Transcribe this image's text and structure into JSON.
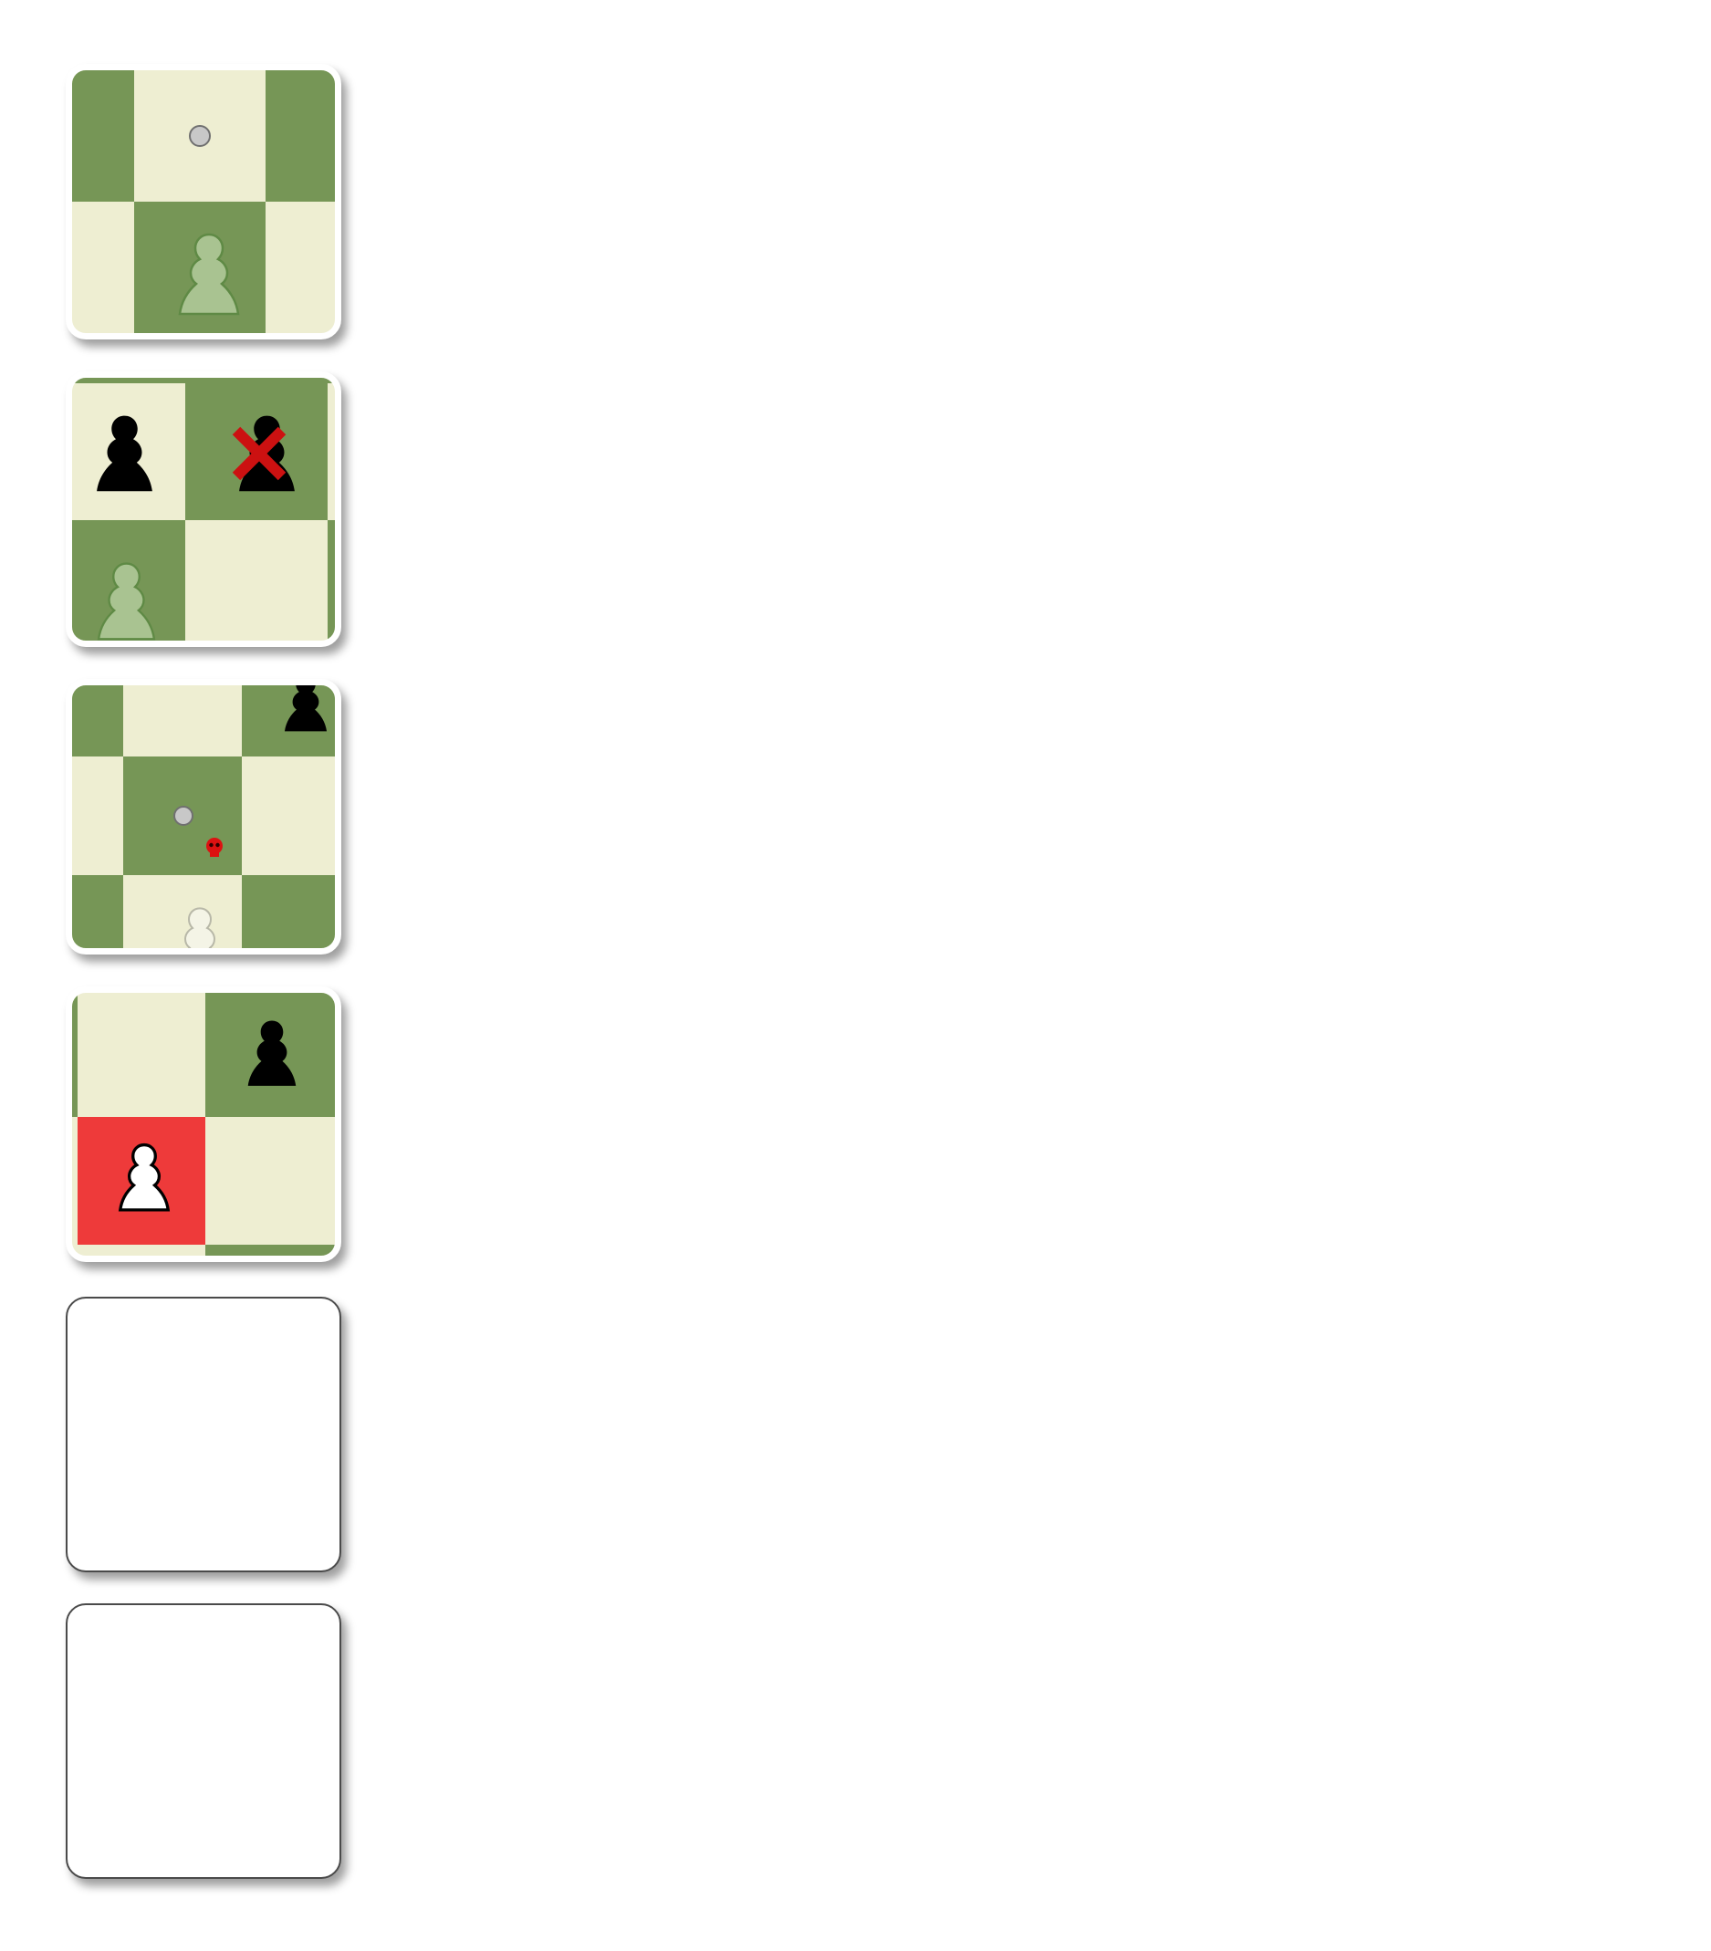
{
  "palette": {
    "light_square": "#eeeed2",
    "dark_square": "#769656",
    "highlight_square": "#ee3a3a",
    "move_dot": "#c8c8c8",
    "capture_cross": "#cc1111",
    "skull_marker": "#dd1111"
  },
  "tutorial_cards": [
    {
      "id": "card-1",
      "content": "pawn-single-step",
      "icons": [
        "ghost-pawn-icon",
        "move-dot-icon"
      ]
    },
    {
      "id": "card-2",
      "content": "blocked-capture",
      "icons": [
        "black-pawn-icon",
        "captured-black-pawn-icon",
        "cross-mark-icon",
        "ghost-pawn-icon"
      ]
    },
    {
      "id": "card-3",
      "content": "danger-square",
      "icons": [
        "black-pawn-icon",
        "move-dot-icon",
        "skull-icon",
        "faded-pawn-icon"
      ]
    },
    {
      "id": "card-4",
      "content": "attacked-pawn",
      "icons": [
        "black-pawn-icon",
        "white-pawn-icon"
      ]
    },
    {
      "id": "card-5",
      "content": "empty"
    },
    {
      "id": "card-6",
      "content": "empty"
    }
  ]
}
